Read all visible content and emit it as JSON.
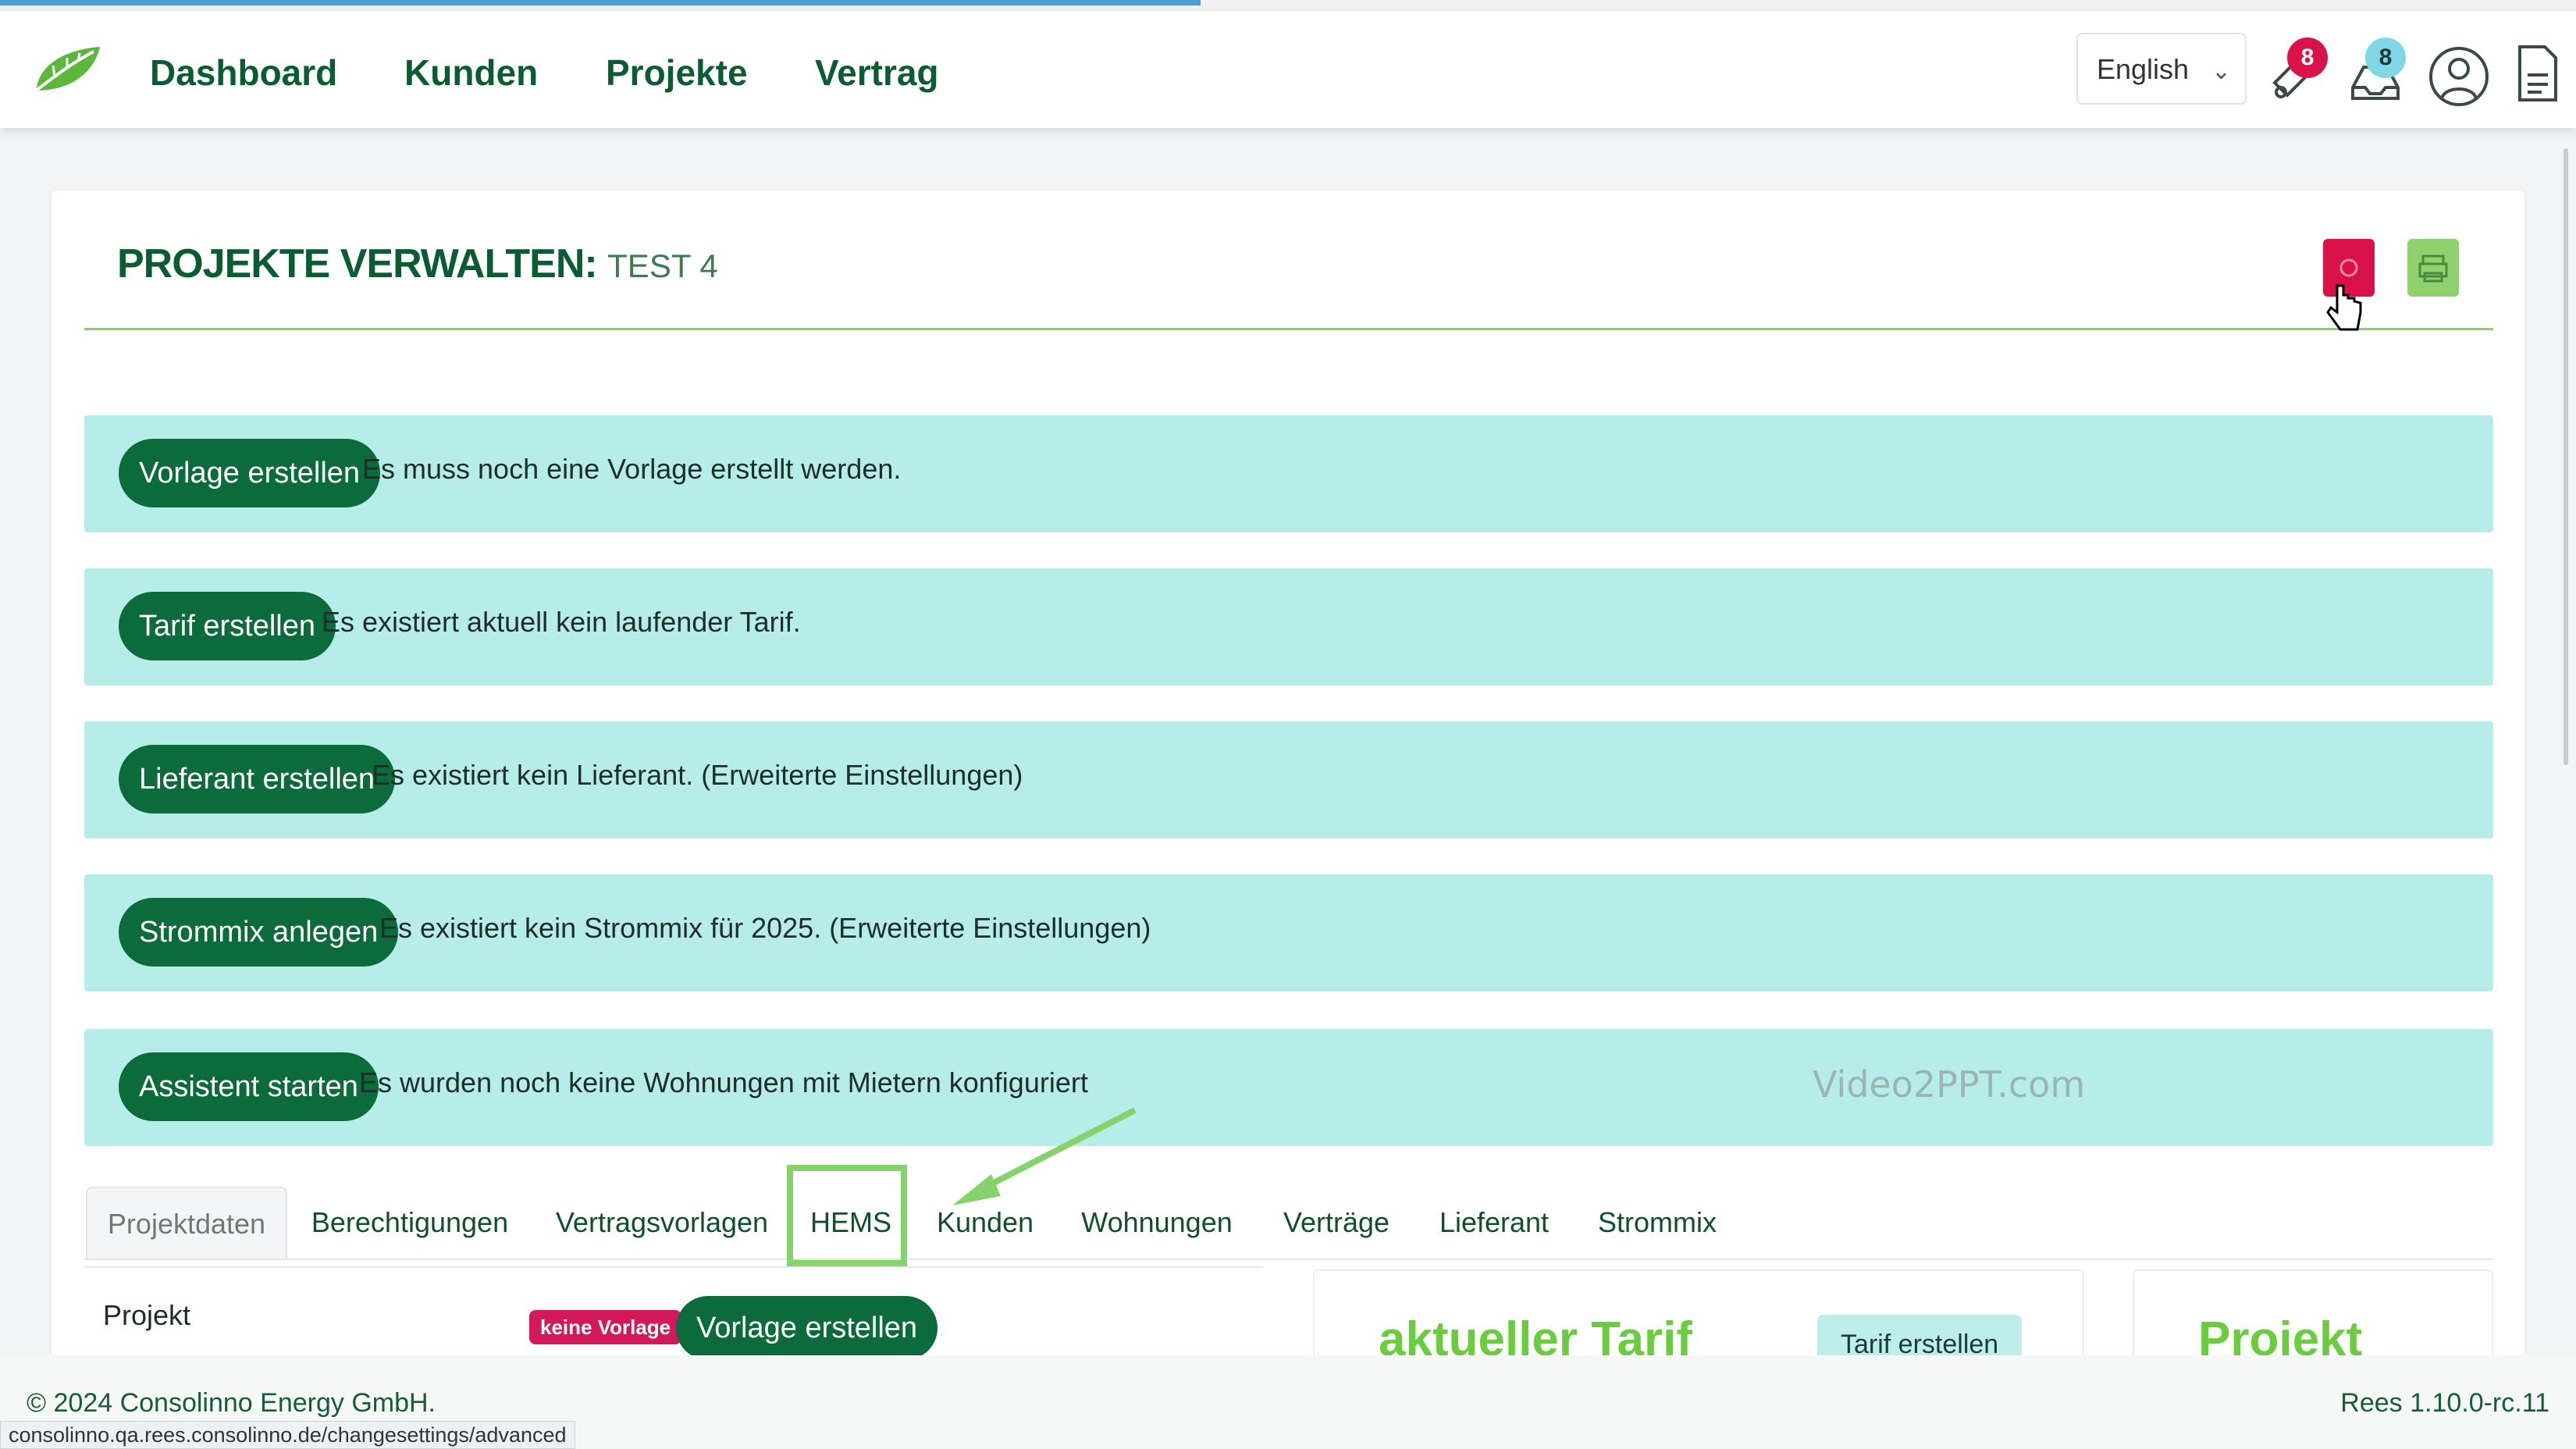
{
  "loading": {
    "progress": 0.466
  },
  "header": {
    "nav": [
      "Dashboard",
      "Kunden",
      "Projekte",
      "Vertrag"
    ],
    "language": "English",
    "notifications_count": "8",
    "messages_count": "8"
  },
  "page": {
    "title": "PROJEKTE VERWALTEN:",
    "subtitle": "TEST 4"
  },
  "alerts": [
    {
      "button": "Vorlage erstellen",
      "text": "Es muss noch eine Vorlage erstellt werden."
    },
    {
      "button": "Tarif erstellen",
      "text": "Es existiert aktuell kein laufender Tarif."
    },
    {
      "button": "Lieferant erstellen",
      "text": "Es existiert kein Lieferant. (Erweiterte Einstellungen)"
    },
    {
      "button": "Strommix anlegen",
      "text": "Es existiert kein Strommix für 2025. (Erweiterte Einstellungen)"
    },
    {
      "button": "Assistent starten",
      "text": "Es wurden noch keine Wohnungen mit Mietern konfiguriert"
    }
  ],
  "watermark": "Video2PPT.com",
  "tabs": [
    "Projektdaten",
    "Berechtigungen",
    "Vertragsvorlagen",
    "HEMS",
    "Kunden",
    "Wohnungen",
    "Verträge",
    "Lieferant",
    "Strommix"
  ],
  "active_tab": "Projektdaten",
  "content": {
    "project_label": "Projekt",
    "badge_keine_vorlage": "keine Vorlage",
    "create_template_button": "Vorlage erstellen",
    "tariff_title": "aktueller Tarif",
    "tariff_button": "Tarif erstellen",
    "project_title": "Projekt"
  },
  "footer": {
    "copyright": "© 2024 Consolinno Energy GmbH.",
    "version": "Rees 1.10.0-rc.11",
    "status_url": "consolinno.qa.rees.consolinno.de/changesettings/advanced"
  },
  "colors": {
    "brand_green": "#0b5b33",
    "button_green": "#0c6b3a",
    "alert_bg": "#b6ede8",
    "danger": "#d9124a",
    "highlight": "#86d26d"
  }
}
